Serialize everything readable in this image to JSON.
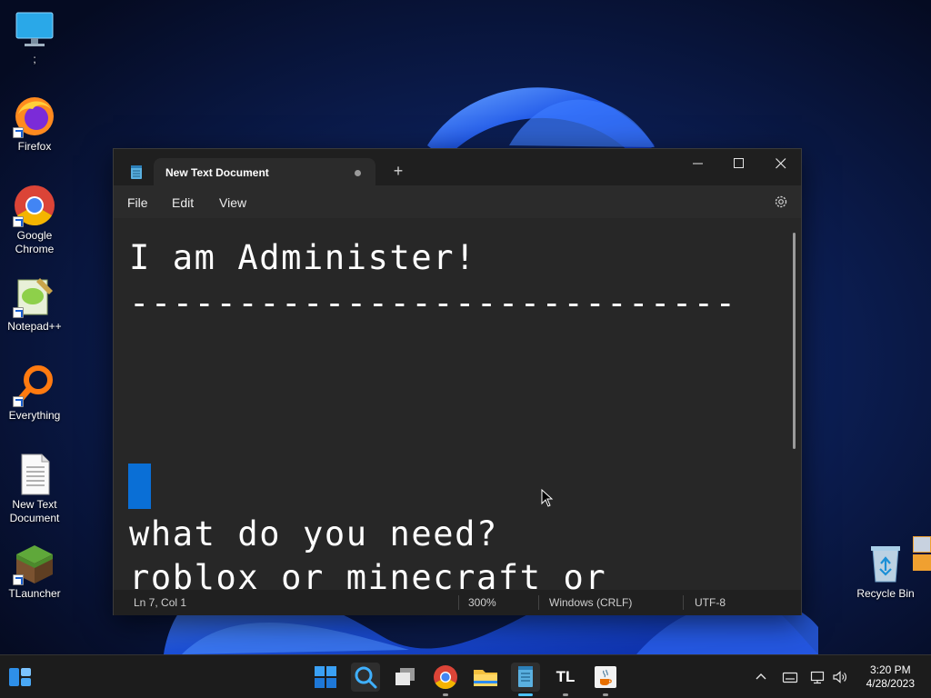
{
  "desktop": {
    "icons": [
      {
        "label": ";",
        "icon": "monitor-icon"
      },
      {
        "label": "Firefox",
        "icon": "firefox-icon"
      },
      {
        "label": "Google Chrome",
        "icon": "chrome-icon"
      },
      {
        "label": "Notepad++",
        "icon": "notepadpp-icon"
      },
      {
        "label": "Everything",
        "icon": "everything-icon"
      },
      {
        "label": "New Text Document",
        "icon": "text-file-icon"
      },
      {
        "label": "TLauncher",
        "icon": "grass-block-icon"
      },
      {
        "label": "Recycle Bin",
        "icon": "recycle-bin-icon"
      }
    ]
  },
  "notepad": {
    "tab_title": "New Text Document",
    "new_tab_symbol": "+",
    "menu": {
      "file": "File",
      "edit": "Edit",
      "view": "View"
    },
    "content": {
      "line1": "I am Administer!",
      "line2": "----------------------------",
      "line3": "what do you need?",
      "line4": "roblox or minecraft or"
    },
    "status": {
      "position": "Ln 7, Col 1",
      "zoom": "300%",
      "line_ending": "Windows (CRLF)",
      "encoding": "UTF-8"
    }
  },
  "taskbar": {
    "apps": [
      "start-icon",
      "search-icon",
      "task-view-icon",
      "chrome-icon",
      "file-explorer-icon",
      "notepad-icon",
      "tlauncher-icon",
      "java-icon"
    ],
    "tlauncher_text": "TL",
    "clock": {
      "time": "3:20 PM",
      "date": "4/28/2023"
    }
  },
  "colors": {
    "accent": "#0a6fd6",
    "window_bg": "#202020",
    "editor_bg": "#272727",
    "taskbar_bg": "#1c1c1c"
  }
}
